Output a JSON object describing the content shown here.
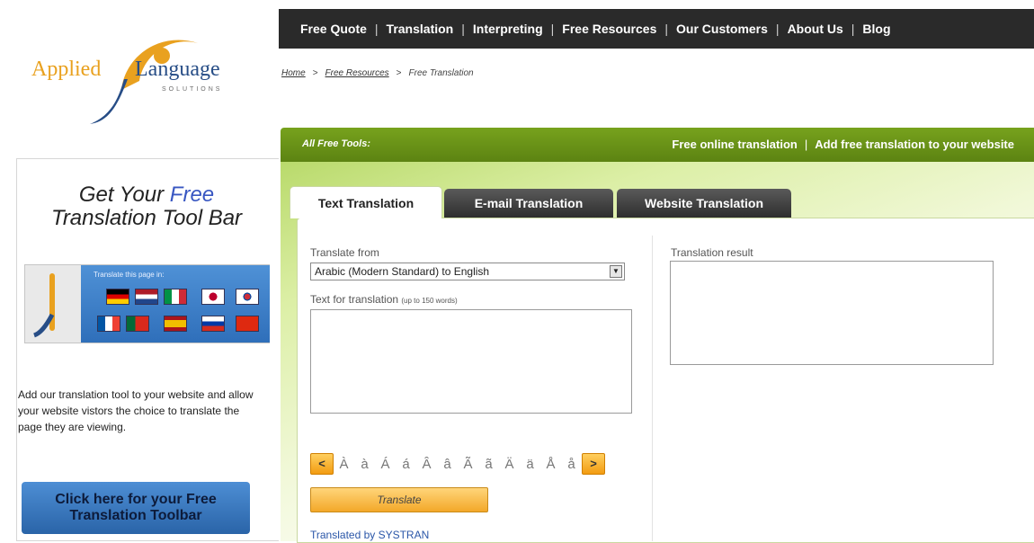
{
  "logo": {
    "word1": "Applied",
    "word2": "Language",
    "tagline": "SOLUTIONS"
  },
  "nav": {
    "items": [
      "Free Quote",
      "Translation",
      "Interpreting",
      "Free Resources",
      "Our Customers",
      "About Us",
      "Blog"
    ]
  },
  "breadcrumb": {
    "home": "Home",
    "resources": "Free Resources",
    "current": "Free Translation"
  },
  "greenbar": {
    "label": "All Free Tools:",
    "link1": "Free online translation",
    "link2": "Add free translation to your website"
  },
  "tabs": {
    "text": "Text Translation",
    "email": "E-mail Translation",
    "website": "Website Translation"
  },
  "form": {
    "translate_from_label": "Translate from",
    "language_pair": "Arabic (Modern Standard) to English",
    "text_label": "Text for translation",
    "text_hint": "(up to 150 words)",
    "result_label": "Translation result",
    "chars": [
      "À",
      "à",
      "Á",
      "á",
      "Â",
      "â",
      "Ã",
      "ã",
      "Ä",
      "ä",
      "Å",
      "å"
    ],
    "prev": "<",
    "next": ">",
    "translate_button": "Translate",
    "credit": "Translated by SYSTRAN"
  },
  "promo": {
    "title_pre": "Get Your",
    "title_free": "Free",
    "title_post": "Translation Tool Bar",
    "toolbar_caption": "Translate this page in:",
    "description": "Add our translation tool to your website and allow your website vistors the choice to translate the page they are viewing.",
    "button": "Click here for your Free Translation Toolbar"
  },
  "colors": {
    "nav_bg": "#2a2a2a",
    "green": "#6a9418",
    "accent_orange": "#f3a829",
    "promo_blue": "#3a78c2"
  }
}
